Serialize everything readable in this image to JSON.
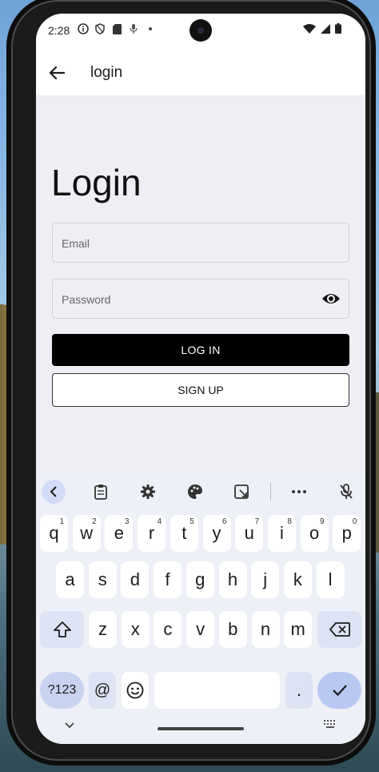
{
  "status": {
    "time": "2:28"
  },
  "appbar": {
    "title": "login"
  },
  "form": {
    "heading": "Login",
    "email_placeholder": "Email",
    "password_placeholder": "Password",
    "login_label": "LOG IN",
    "signup_label": "SIGN UP"
  },
  "keyboard": {
    "row1": [
      {
        "k": "q",
        "n": "1"
      },
      {
        "k": "w",
        "n": "2"
      },
      {
        "k": "e",
        "n": "3"
      },
      {
        "k": "r",
        "n": "4"
      },
      {
        "k": "t",
        "n": "5"
      },
      {
        "k": "y",
        "n": "6"
      },
      {
        "k": "u",
        "n": "7"
      },
      {
        "k": "i",
        "n": "8"
      },
      {
        "k": "o",
        "n": "9"
      },
      {
        "k": "p",
        "n": "0"
      }
    ],
    "row2": [
      "a",
      "s",
      "d",
      "f",
      "g",
      "h",
      "j",
      "k",
      "l"
    ],
    "row3": [
      "z",
      "x",
      "c",
      "v",
      "b",
      "n",
      "m"
    ],
    "sym_label": "?123",
    "at_label": "@",
    "period_label": "."
  },
  "colors": {
    "accent": "#b9c8f3",
    "primary_button": "#000000"
  }
}
